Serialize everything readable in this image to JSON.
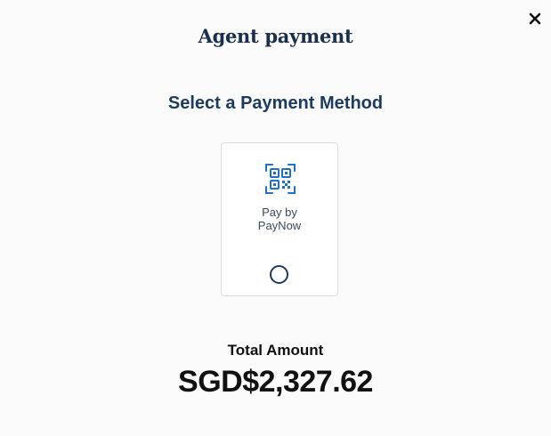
{
  "modal": {
    "title": "Agent payment",
    "close_icon": "close-icon"
  },
  "payment": {
    "heading": "Select a Payment Method",
    "methods": [
      {
        "label": "Pay by\nPayNow",
        "icon": "qr-code-icon",
        "selected": false
      }
    ]
  },
  "total": {
    "label": "Total Amount",
    "amount": "SGD$2,327.62"
  },
  "colors": {
    "title": "#1a2f4c",
    "heading": "#1c3b5f",
    "icon_accent": "#1f6fd1",
    "card_border": "#dcdcdc",
    "text_dark": "#111111"
  }
}
